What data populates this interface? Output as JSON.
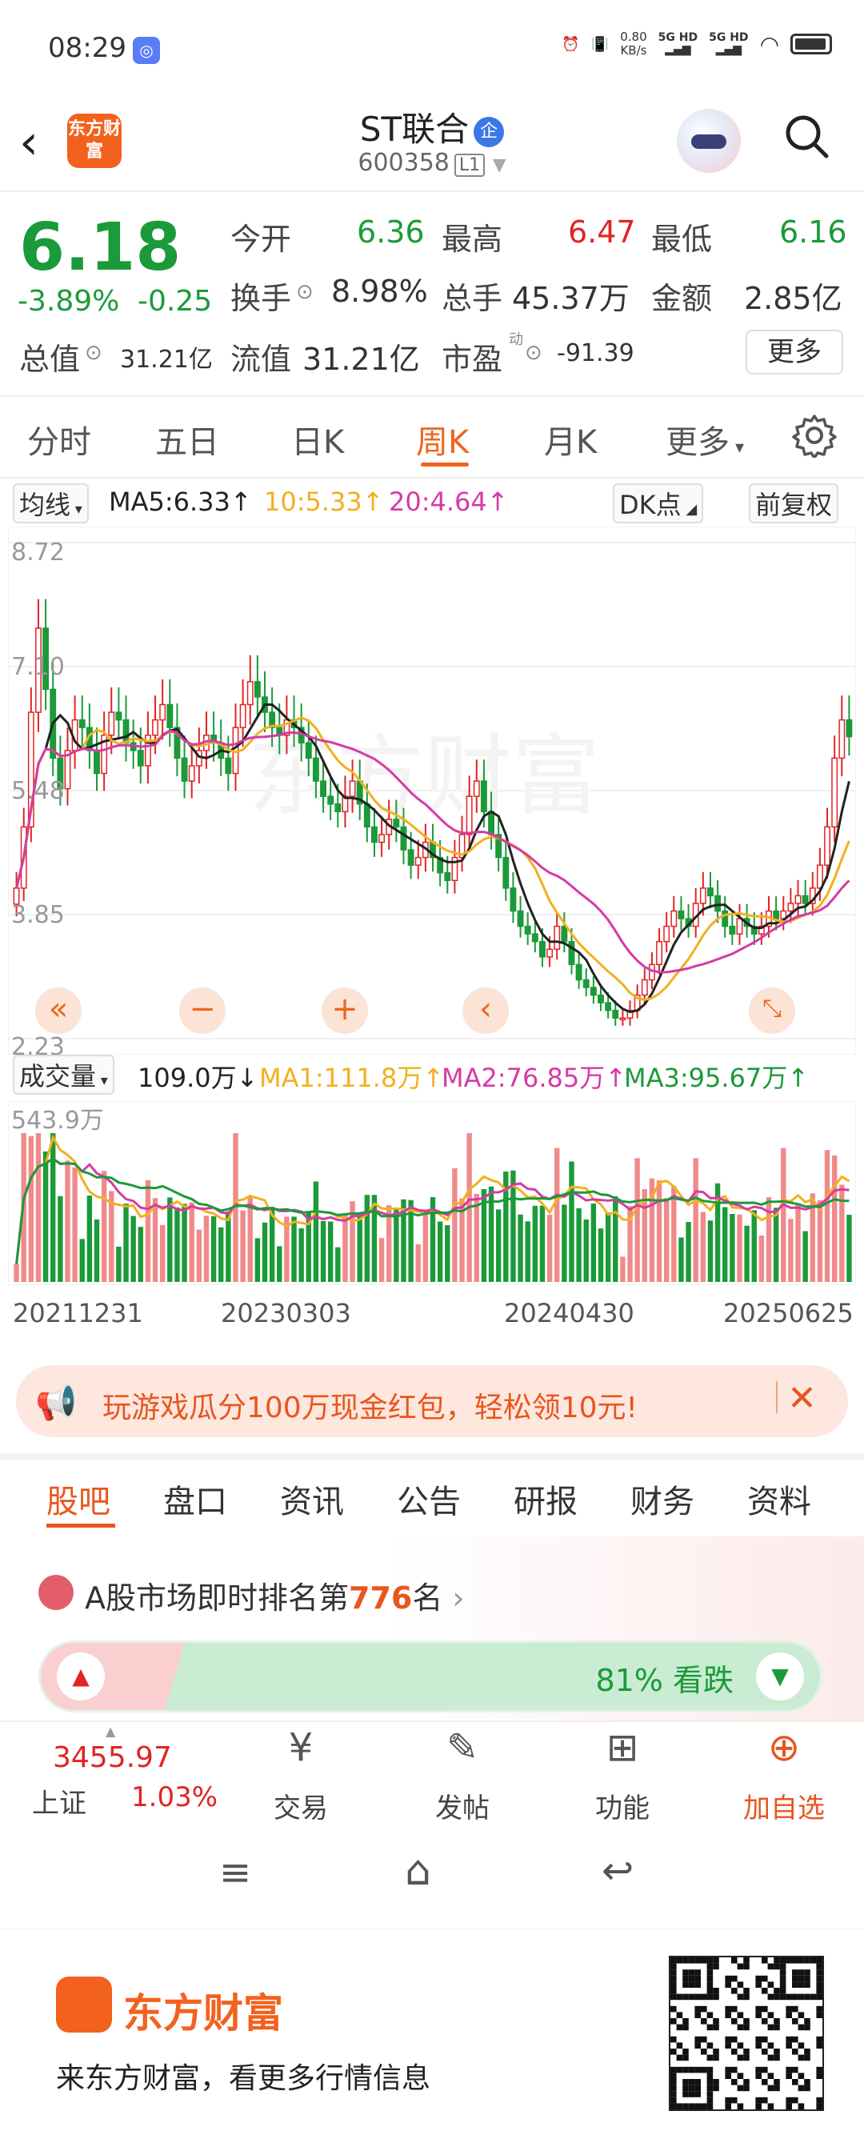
{
  "status_bar": {
    "time": "08:29",
    "net_speed": "0.80",
    "net_unit": "KB/s",
    "sig1": "5G HD",
    "sig2": "5G HD"
  },
  "header": {
    "logo_text": "东方财富",
    "name": "ST联合",
    "qi_badge": "企",
    "code": "600358",
    "level": "L1"
  },
  "quote": {
    "price": "6.18",
    "pct": "-3.89%",
    "change": "-0.25",
    "open_label": "今开",
    "open": "6.36",
    "high_label": "最高",
    "high": "6.47",
    "low_label": "最低",
    "low": "6.16",
    "turnover_label": "换手",
    "turnover": "8.98%",
    "volume_label": "总手",
    "volume": "45.37万",
    "amount_label": "金额",
    "amount": "2.85亿",
    "total_cap_label": "总值",
    "total_cap": "31.21亿",
    "float_cap_label": "流值",
    "float_cap": "31.21亿",
    "pe_label": "市盈",
    "pe_mark": "动",
    "pe": "-91.39",
    "more": "更多"
  },
  "tabs": [
    "分时",
    "五日",
    "日K",
    "周K",
    "月K",
    "更多"
  ],
  "active_tab": "周K",
  "ma_bar": {
    "selector": "均线",
    "ma5": "MA5:6.33",
    "ma10": "10:5.33",
    "ma20": "20:4.64",
    "dk": "DK点",
    "adjust": "前复权"
  },
  "price_axis": [
    "8.72",
    "7.10",
    "5.48",
    "3.85",
    "2.23"
  ],
  "vol_bar": {
    "selector": "成交量",
    "vol": "109.0万",
    "ma1": "MA1:111.8万",
    "ma2": "MA2:76.85万",
    "ma3": "MA3:95.67万"
  },
  "vol_axis_max": "543.9万",
  "dates": [
    "20211231",
    "20230303",
    "20240430",
    "20250625"
  ],
  "colors": {
    "up": "#e02424",
    "down": "#1b9a39",
    "ma5": "#222222",
    "ma10": "#f2b01e",
    "ma20": "#d63aa5",
    "accent": "#f0651c"
  },
  "banner": {
    "text": "玩游戏瓜分100万现金红包，轻松领10元!"
  },
  "sub_tabs": [
    "股吧",
    "盘口",
    "资讯",
    "公告",
    "研报",
    "财务",
    "资料"
  ],
  "rank": {
    "prefix": "A股市场即时排名第",
    "number": "776",
    "suffix": "名"
  },
  "vote": {
    "text": "81% 看跌"
  },
  "bottom_nav": {
    "index_value": "3455.97",
    "index_name": "上证",
    "index_pct": "1.03%",
    "items": [
      "交易",
      "发帖",
      "功能",
      "加自选"
    ]
  },
  "footer": {
    "brand": "东方财富",
    "slogan": "来东方财富，看更多行情信息"
  },
  "chart_data": {
    "type": "candlestick",
    "period": "weekly",
    "y_range": [
      2.23,
      8.72
    ],
    "x_labels": [
      "20211231",
      "20230303",
      "20240430",
      "20250625"
    ],
    "close": [
      4.2,
      5.0,
      6.5,
      7.6,
      6.8,
      5.9,
      5.5,
      6.0,
      6.4,
      6.3,
      6.0,
      5.7,
      6.2,
      6.5,
      6.4,
      6.1,
      6.0,
      5.8,
      6.2,
      6.4,
      6.6,
      6.3,
      5.9,
      5.6,
      5.8,
      6.0,
      6.2,
      6.1,
      5.9,
      5.7,
      6.3,
      6.6,
      6.9,
      6.7,
      6.5,
      6.3,
      6.2,
      6.4,
      6.3,
      6.1,
      5.9,
      5.6,
      5.4,
      5.3,
      5.2,
      5.4,
      5.6,
      5.3,
      5.0,
      4.8,
      4.9,
      5.1,
      5.0,
      4.7,
      4.5,
      4.6,
      4.8,
      4.6,
      4.4,
      4.3,
      4.6,
      4.9,
      5.4,
      5.6,
      5.2,
      4.9,
      4.6,
      4.2,
      3.9,
      3.7,
      3.6,
      3.5,
      3.3,
      3.4,
      3.7,
      3.5,
      3.2,
      3.0,
      2.9,
      2.8,
      2.7,
      2.6,
      2.5,
      2.5,
      2.6,
      2.8,
      3.0,
      3.2,
      3.5,
      3.7,
      3.9,
      3.8,
      3.7,
      4.0,
      4.2,
      4.1,
      3.9,
      3.7,
      3.6,
      3.8,
      3.7,
      3.6,
      3.7,
      3.9,
      3.8,
      3.9,
      4.0,
      4.1,
      4.0,
      4.2,
      4.5,
      5.0,
      5.9,
      6.4,
      6.18
    ],
    "ma5_last": 6.33,
    "ma10_last": 5.33,
    "ma20_last": 4.64,
    "volume_max": "543.9万",
    "volume_last": "109.0万"
  }
}
